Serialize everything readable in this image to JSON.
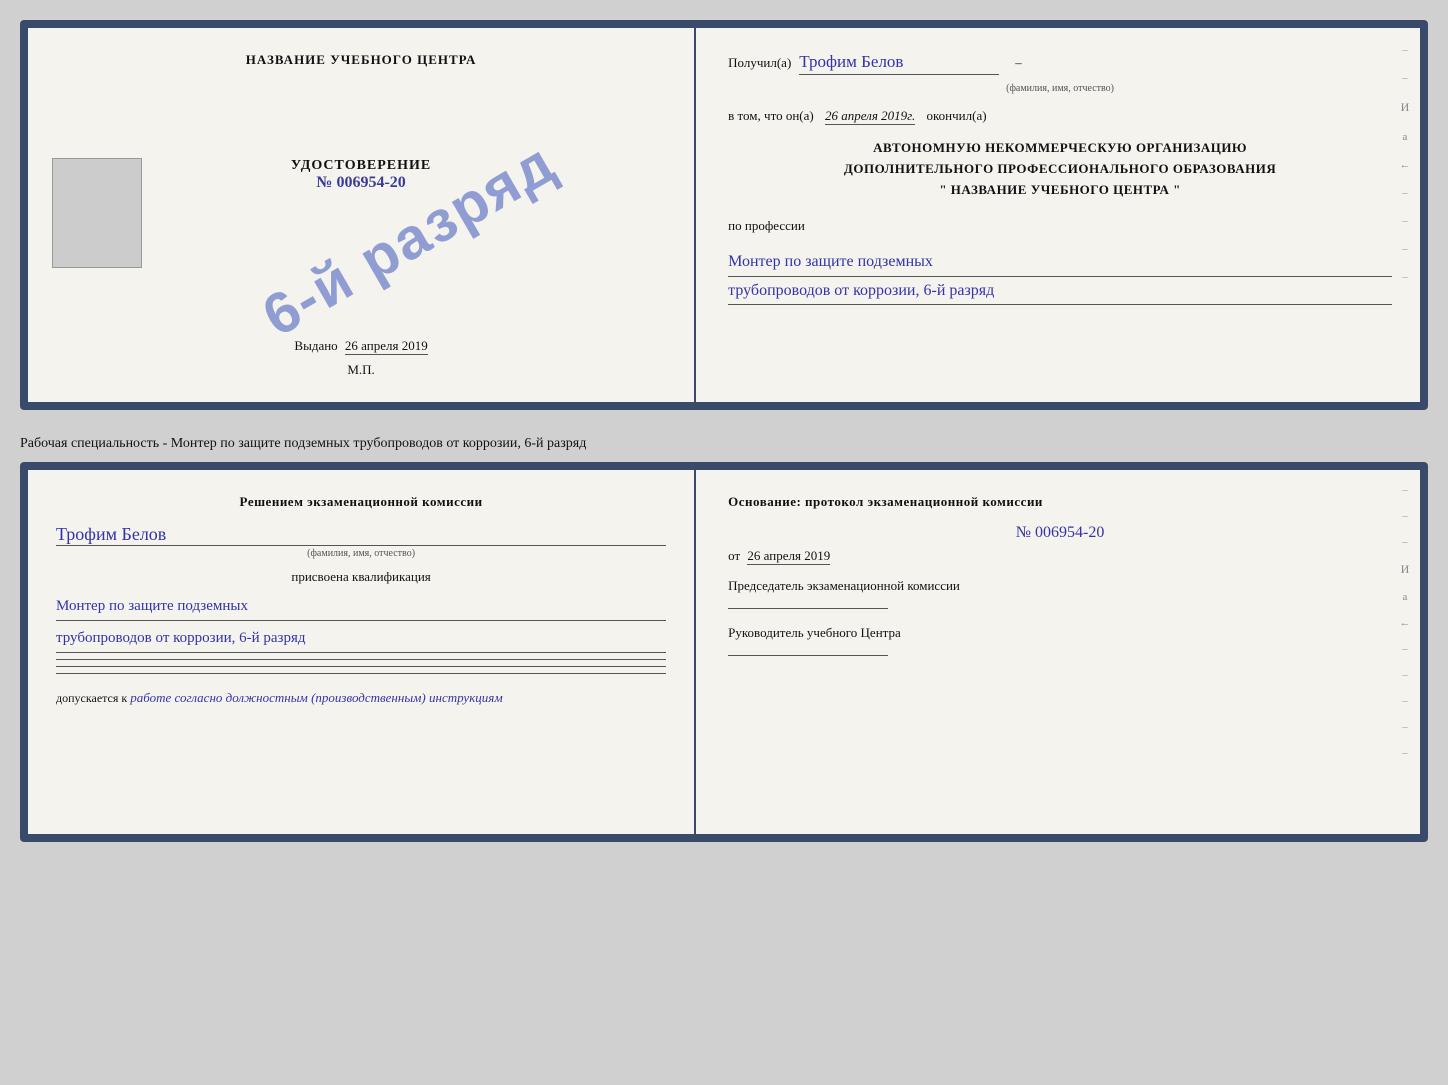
{
  "top_cert": {
    "left": {
      "title": "НАЗВАНИЕ УЧЕБНОГО ЦЕНТРА",
      "udostoverenie_label": "УДОСТОВЕРЕНИЕ",
      "number": "№ 006954-20",
      "vydano_label": "Выдано",
      "vydano_date": "26 апреля 2019",
      "mp": "М.П.",
      "stamp_text": "6-й разряд"
    },
    "right": {
      "poluchil_label": "Получил(а)",
      "recipient_name": "Трофим Белов",
      "fio_caption": "(фамилия, имя, отчество)",
      "dash": "–",
      "vtom_label": "в том, что он(а)",
      "completion_date": "26 апреля 2019г.",
      "okonchil_label": "окончил(а)",
      "org_line1": "АВТОНОМНУЮ НЕКОММЕРЧЕСКУЮ ОРГАНИЗАЦИЮ",
      "org_line2": "ДОПОЛНИТЕЛЬНОГО ПРОФЕССИОНАЛЬНОГО ОБРАЗОВАНИЯ",
      "org_line3": "\"  НАЗВАНИЕ УЧЕБНОГО ЦЕНТРА  \"",
      "po_professii": "по профессии",
      "profession_line1": "Монтер по защите подземных",
      "profession_line2": "трубопроводов от коррозии, 6-й разряд"
    }
  },
  "specialty_line": "Рабочая специальность - Монтер по защите подземных трубопроводов от коррозии, 6-й разряд",
  "bottom_cert": {
    "left": {
      "resheniem_title": "Решением экзаменационной комиссии",
      "recipient_name": "Трофим Белов",
      "fio_caption": "(фамилия, имя, отчество)",
      "prisvoena_label": "присвоена квалификация",
      "qualification_line1": "Монтер по защите подземных",
      "qualification_line2": "трубопроводов от коррозии, 6-й разряд",
      "dopuskaetsya_label": "допускается к",
      "dopusk_text": "работе согласно должностным (производственным) инструкциям"
    },
    "right": {
      "osnovanie_title": "Основание: протокол экзаменационной комиссии",
      "protocol_number": "№ 006954-20",
      "ot_label": "от",
      "ot_date": "26 апреля 2019",
      "chairman_label": "Председатель экзаменационной комиссии",
      "director_label": "Руководитель учебного Центра"
    }
  }
}
